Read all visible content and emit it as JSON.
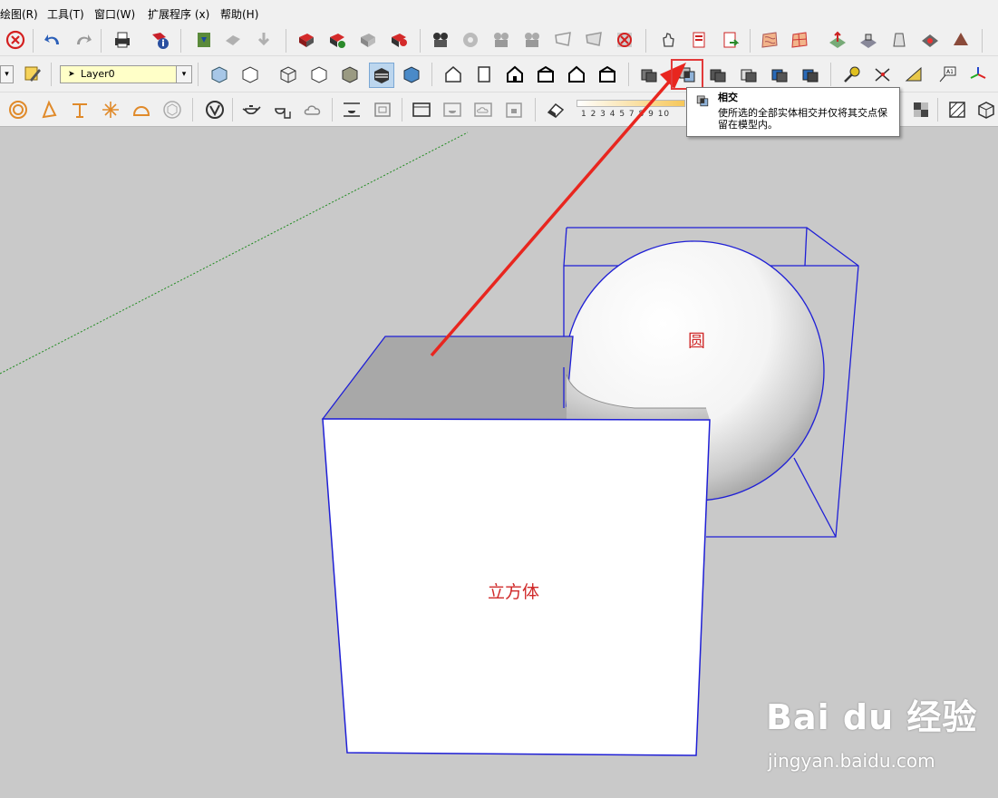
{
  "menu": {
    "items": [
      "绘图(R)",
      "工具(T)",
      "窗口(W)",
      "扩展程序 (x)",
      "帮助(H)"
    ]
  },
  "layer": {
    "current": "Layer0"
  },
  "tooltip": {
    "title": "相交",
    "description": "使所选的全部实体相交并仅将其交点保留在模型内。",
    "icon": "solid-intersect-icon"
  },
  "scale": {
    "ticks": "1 2 3 4 5  7 8 9 10"
  },
  "scene": {
    "cube_label": "立方体",
    "sphere_label": "圆",
    "selection_color": "#1f1fd6",
    "annotation_color": "#e8261f",
    "axis_color": "#1e8a1e"
  },
  "watermark": {
    "logo": "Bai du 经验",
    "url": "jingyan.baidu.com"
  }
}
